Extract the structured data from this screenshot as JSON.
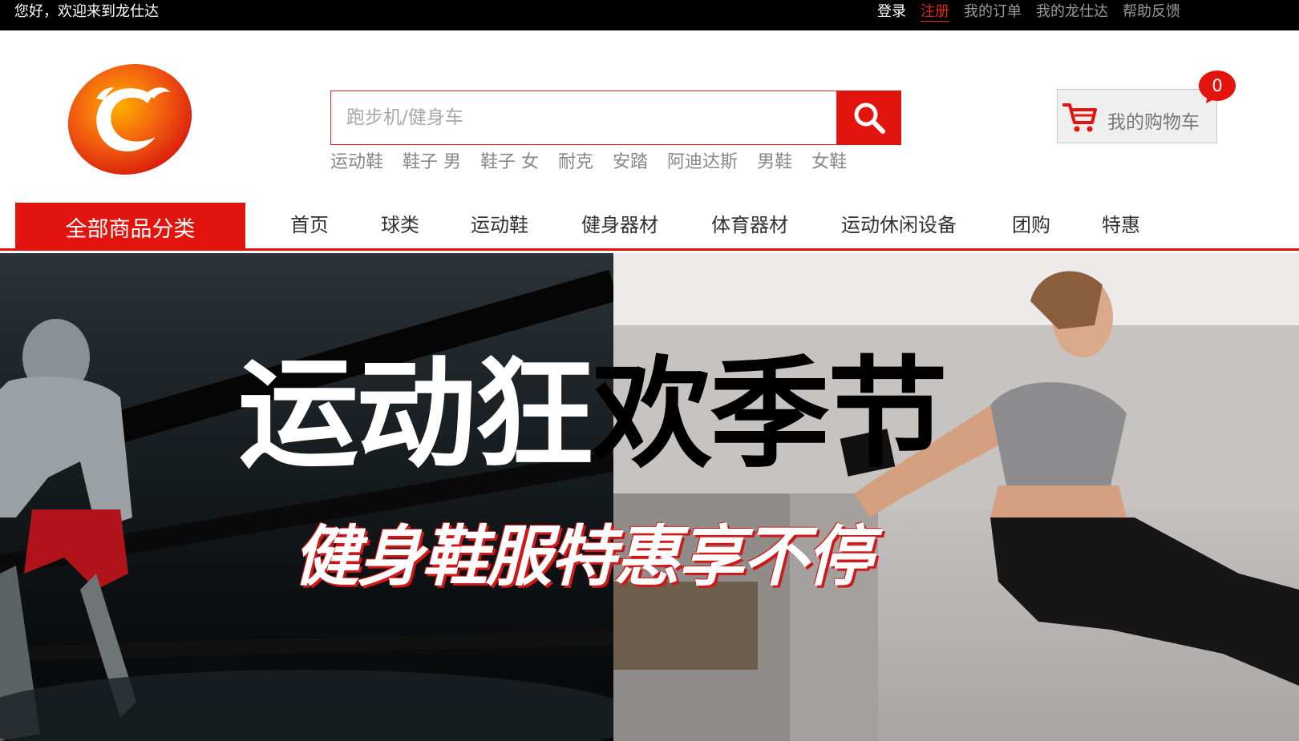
{
  "topbar": {
    "welcome": "您好，欢迎来到龙仕达",
    "links": {
      "login": "登录",
      "register": "注册",
      "orders": "我的订单",
      "account": "我的龙仕达",
      "help": "帮助反馈"
    }
  },
  "search": {
    "placeholder": "跑步机/健身车",
    "hotwords": [
      "运动鞋",
      "鞋子 男",
      "鞋子 女",
      "耐克",
      "安踏",
      "阿迪达斯",
      "男鞋",
      "女鞋"
    ]
  },
  "cart": {
    "label": "我的购物车",
    "count": "0"
  },
  "nav": {
    "all_categories": "全部商品分类",
    "items": [
      "首页",
      "球类",
      "运动鞋",
      "健身器材",
      "体育器材",
      "运动休闲设备",
      "团购",
      "特惠"
    ]
  },
  "banner": {
    "headline_part1": "运动狂",
    "headline_part2": "欢季节",
    "subline": "健身鞋服特惠享不停"
  },
  "colors": {
    "brand_red": "#e3140d",
    "topbar_bg": "#000000"
  }
}
